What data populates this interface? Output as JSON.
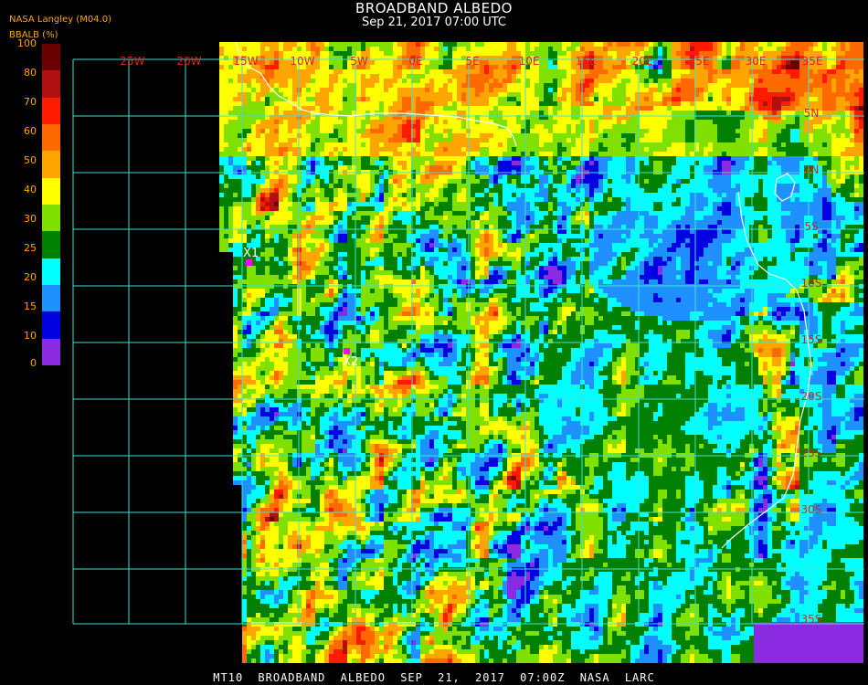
{
  "header": {
    "title": "BROADBAND ALBEDO",
    "datetime": "Sep 21, 2017 07:00 UTC"
  },
  "source_label": "NASA Langley (M04.0)",
  "legend": {
    "label": "BBALB (%)",
    "ticks": [
      "100",
      "80",
      "70",
      "60",
      "50",
      "40",
      "30",
      "25",
      "20",
      "15",
      "10",
      "0"
    ],
    "colors": [
      "#6a0000",
      "#b01010",
      "#ff1a00",
      "#ff6a00",
      "#ffa500",
      "#ffff00",
      "#80e000",
      "#008000",
      "#00ffff",
      "#1e90ff",
      "#0000e0",
      "#8a2be2"
    ]
  },
  "grid": {
    "longitude_labels": [
      "25W",
      "20W",
      "15W",
      "10W",
      "5W",
      "0E",
      "5E",
      "10E",
      "15E",
      "20E",
      "25E",
      "30E",
      "35E"
    ],
    "latitude_labels": [
      "5N",
      "0N",
      "5S",
      "10S",
      "15S",
      "20S",
      "25S",
      "30S",
      "35S"
    ],
    "color": "#40e0d0"
  },
  "markers": [
    {
      "label": "X1",
      "color": "#ff00ff"
    },
    {
      "label": "X2",
      "color": "#ff00ff"
    }
  ],
  "footer": "MT10 BROADBAND ALBEDO SEP 21, 2017 07:00Z NASA LARC"
}
